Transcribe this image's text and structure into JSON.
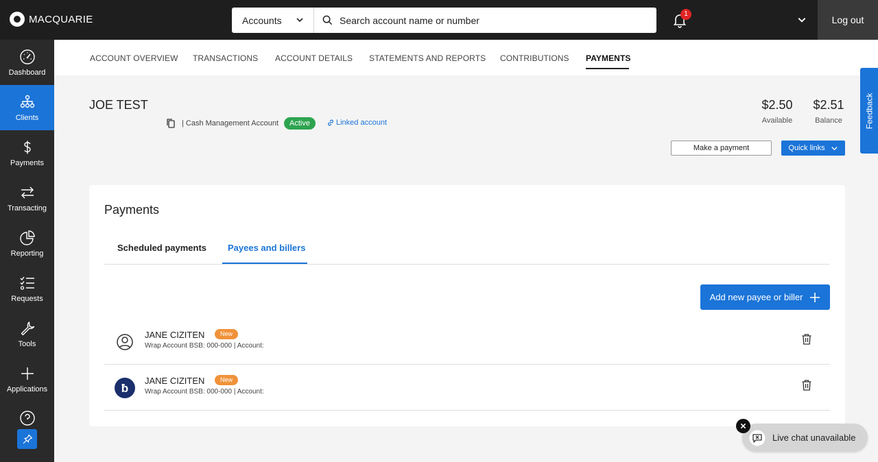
{
  "brand": {
    "name": "MACQUARIE"
  },
  "header": {
    "account_select": "Accounts",
    "search_placeholder": "Search account name or number",
    "notification_count": "1",
    "logout_label": "Log out"
  },
  "sidenav": {
    "items": [
      {
        "label": "Dashboard",
        "icon": "dashboard-gauge-icon"
      },
      {
        "label": "Clients",
        "icon": "clients-hierarchy-icon"
      },
      {
        "label": "Payments",
        "icon": "dollar-icon"
      },
      {
        "label": "Transacting",
        "icon": "transfer-arrows-icon"
      },
      {
        "label": "Reporting",
        "icon": "pie-chart-icon"
      },
      {
        "label": "Requests",
        "icon": "checklist-icon"
      },
      {
        "label": "Tools",
        "icon": "wrench-icon"
      },
      {
        "label": "Applications",
        "icon": "plus-icon"
      }
    ],
    "active": "Clients"
  },
  "tabs": [
    "ACCOUNT OVERVIEW",
    "TRANSACTIONS",
    "ACCOUNT DETAILS",
    "STATEMENTS AND REPORTS",
    "CONTRIBUTIONS",
    "PAYMENTS"
  ],
  "active_tab": "PAYMENTS",
  "account": {
    "name": "JOE TEST",
    "type": "| Cash Management Account",
    "status": "Active",
    "linked_label": "Linked account",
    "available_value": "$2.50",
    "available_label": "Available",
    "balance_value": "$2.51",
    "balance_label": "Balance",
    "make_payment_label": "Make a payment",
    "quick_links_label": "Quick links"
  },
  "feedback_label": "Feedback",
  "payments": {
    "title": "Payments",
    "subtabs": [
      "Scheduled payments",
      "Payees and billers"
    ],
    "active_subtab": "Payees and billers",
    "add_button_label": "Add new payee or biller",
    "payees": [
      {
        "name": "JANE CIZITEN",
        "badge": "New",
        "detail": "Wrap Account BSB: 000-000 | Account:",
        "avatar": "user-circle-icon"
      },
      {
        "name": "JANE CIZITEN",
        "badge": "New",
        "detail": "Wrap Account BSB: 000-000 | Account:",
        "avatar": "bpay-icon"
      }
    ]
  },
  "chat": {
    "label": "Live chat unavailable"
  },
  "colors": {
    "primary": "#1b74d8",
    "topbar": "#1e1e1e",
    "sidenav": "#2a2a2a",
    "active_badge": "#2ea44f",
    "new_badge": "#f0923a",
    "notification_badge": "#e02424"
  }
}
